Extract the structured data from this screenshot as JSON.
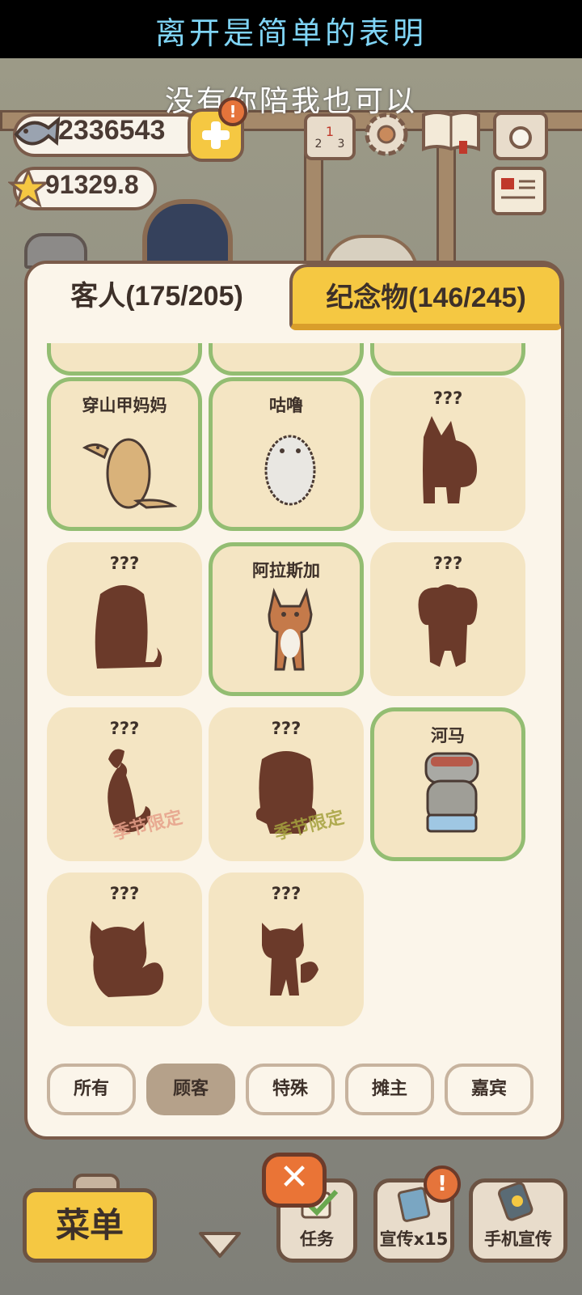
{
  "banner": {
    "line1": "离开是简单的表明",
    "line2": "没有你陪我也可以"
  },
  "currency": {
    "fish": "2336543",
    "stars": "91329.8"
  },
  "tabs": {
    "guests": "客人(175/205)",
    "souvenirs": "纪念物(146/245)"
  },
  "cards": [
    {
      "name": "穿山甲妈妈",
      "found": true
    },
    {
      "name": "咕噜",
      "found": true
    },
    {
      "name": "???",
      "found": false
    },
    {
      "name": "???",
      "found": false
    },
    {
      "name": "阿拉斯加",
      "found": true
    },
    {
      "name": "???",
      "found": false
    },
    {
      "name": "???",
      "found": false,
      "badge": "季节限定"
    },
    {
      "name": "???",
      "found": false,
      "badge": "季节限定"
    },
    {
      "name": "河马",
      "found": true
    },
    {
      "name": "???",
      "found": false
    },
    {
      "name": "???",
      "found": false
    }
  ],
  "filters": [
    "所有",
    "顾客",
    "特殊",
    "摊主",
    "嘉宾"
  ],
  "active_filter": "顾客",
  "bottom": {
    "menu": "菜单",
    "tasks": "任务",
    "promo": "宣传x15",
    "phone_promo": "手机宣传"
  },
  "colors": {
    "found_border": "#93bd72",
    "card_bg": "#f4e5c3",
    "silhouette": "#6b3a2a",
    "accent_yellow": "#f5c842"
  }
}
